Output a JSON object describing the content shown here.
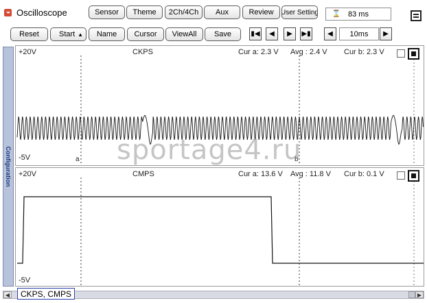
{
  "app": {
    "title": "Oscilloscope",
    "record_time": "83 ms"
  },
  "toolbar1": {
    "buttons": [
      "Sensor",
      "Theme",
      "2Ch/4Ch",
      "Aux",
      "Review",
      "User Setting"
    ]
  },
  "toolbar2": {
    "buttons": [
      "Reset",
      "Start",
      "Name",
      "Cursor",
      "ViewAll",
      "Save"
    ],
    "time_scale": "10ms"
  },
  "side_tab": "Configuration",
  "channels": [
    {
      "name": "CKPS",
      "vmax": "+20V",
      "vmin": "-5V",
      "cur_a": "Cur a: 2.3 V",
      "avg": "Avg  : 2.4 V",
      "cur_b": "Cur b: 2.3 V",
      "cursor_a": "a",
      "cursor_b": "b"
    },
    {
      "name": "CMPS",
      "vmax": "+20V",
      "vmin": "-5V",
      "cur_a": "Cur a: 13.6 V",
      "avg": "Avg  : 11.8 V",
      "cur_b": "Cur b: 0.1 V"
    }
  ],
  "status": {
    "selected_channels": "CKPS, CMPS"
  },
  "watermark": "sportage4.ru",
  "colors": {
    "accent": "#2a3fa8",
    "side_tab": "#b7c2dc",
    "app_icon": "#d44b32"
  }
}
